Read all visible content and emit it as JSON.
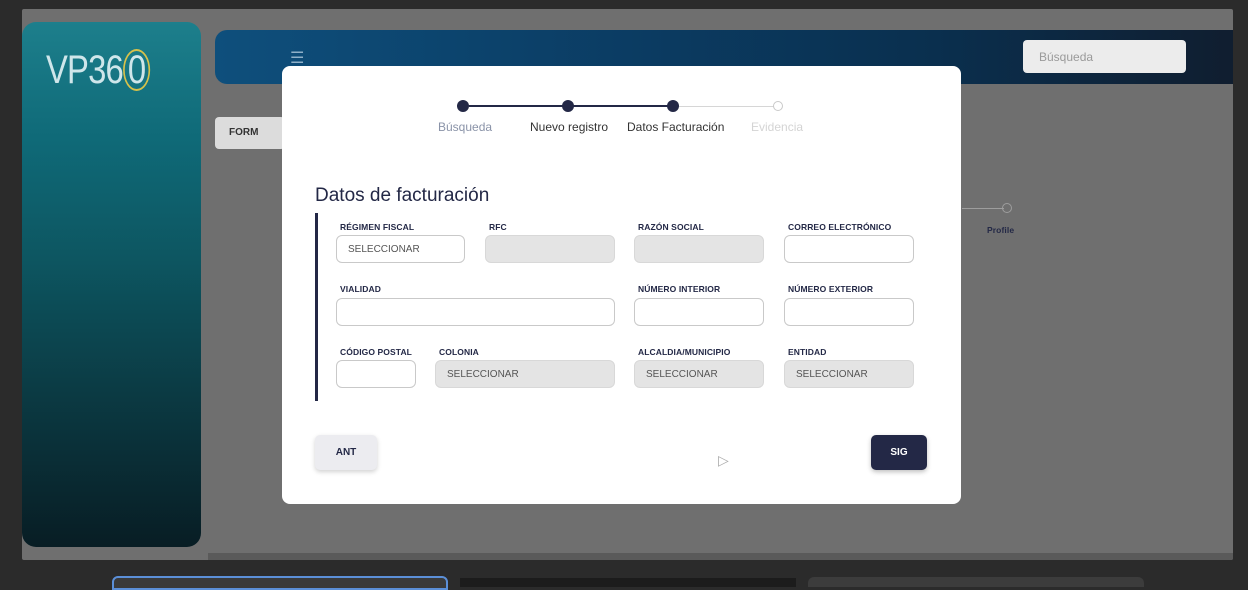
{
  "app": {
    "logo_text": "VP36",
    "logo_ring_text": "0"
  },
  "topbar": {
    "menu_icon": "hamburger-icon",
    "search_placeholder": "Búsqueda"
  },
  "background": {
    "form_tab": "FORM",
    "step_label": "Profile"
  },
  "modal": {
    "stepper": [
      {
        "label": "Búsqueda",
        "state": "done"
      },
      {
        "label": "Nuevo registro",
        "state": "done"
      },
      {
        "label": "Datos Facturación",
        "state": "current"
      },
      {
        "label": "Evidencia",
        "state": "pending"
      }
    ],
    "section_title": "Datos de facturación",
    "fields": {
      "regimen_fiscal": {
        "label": "RÉGIMEN FISCAL",
        "value": "SELECCIONAR"
      },
      "rfc": {
        "label": "RFC",
        "value": ""
      },
      "razon_social": {
        "label": "RAZÓN SOCIAL",
        "value": ""
      },
      "correo": {
        "label": "CORREO ELECTRÓNICO",
        "value": ""
      },
      "vialidad": {
        "label": "VIALIDAD",
        "value": ""
      },
      "numero_interior": {
        "label": "NÚMERO INTERIOR",
        "value": ""
      },
      "numero_exterior": {
        "label": "NÚMERO EXTERIOR",
        "value": ""
      },
      "codigo_postal": {
        "label": "CÓDIGO POSTAL",
        "value": ""
      },
      "colonia": {
        "label": "COLONIA",
        "value": "SELECCIONAR"
      },
      "alcaldia": {
        "label": "ALCALDIA/MUNICIPIO",
        "value": "SELECCIONAR"
      },
      "entidad": {
        "label": "ENTIDAD",
        "value": "SELECCIONAR"
      }
    },
    "buttons": {
      "prev": "ANT",
      "next": "SIG"
    }
  },
  "colors": {
    "primary": "#232846",
    "accent_ring": "#d8c24a"
  }
}
